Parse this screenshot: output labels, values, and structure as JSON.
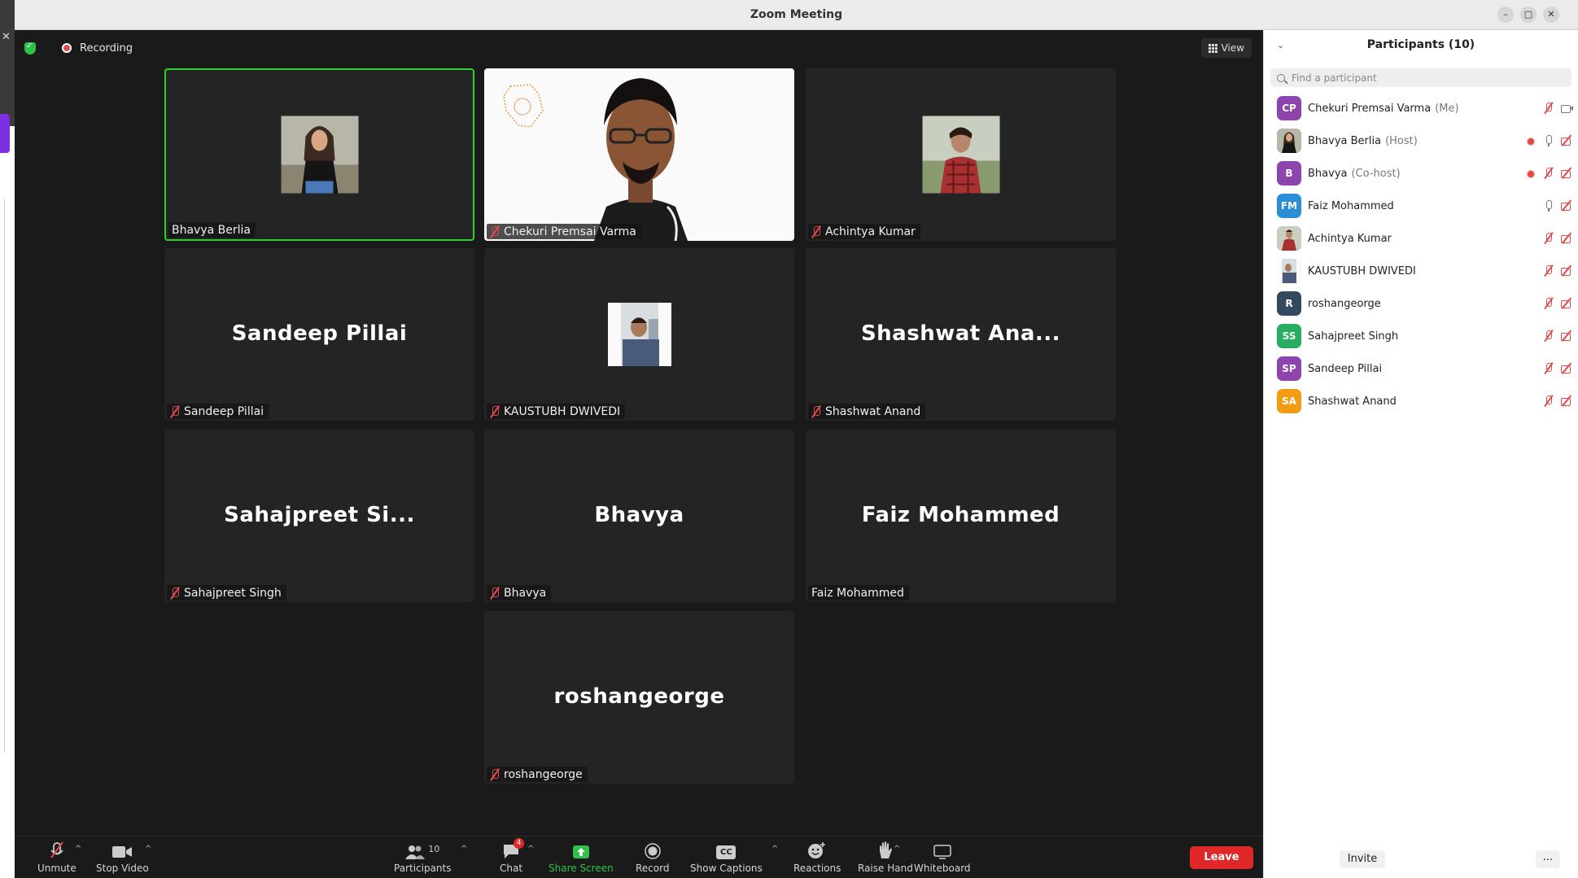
{
  "window": {
    "title": "Zoom Meeting"
  },
  "status": {
    "recording_label": "Recording",
    "view_label": "View"
  },
  "tiles": [
    {
      "display_name": "",
      "tag": "Bhavya Berlia"
    },
    {
      "display_name": "",
      "tag": "Chekuri Premsai Varma"
    },
    {
      "display_name": "",
      "tag": "Achintya Kumar"
    },
    {
      "display_name": "Sandeep Pillai",
      "tag": "Sandeep Pillai"
    },
    {
      "display_name": "",
      "tag": "KAUSTUBH DWIVEDI"
    },
    {
      "display_name": "Shashwat Ana...",
      "tag": "Shashwat Anand"
    },
    {
      "display_name": "Sahajpreet Si...",
      "tag": "Sahajpreet Singh"
    },
    {
      "display_name": "Bhavya",
      "tag": "Bhavya"
    },
    {
      "display_name": "Faiz Mohammed",
      "tag": "Faiz Mohammed"
    },
    {
      "display_name": "roshangeorge",
      "tag": "roshangeorge"
    }
  ],
  "toolbar": {
    "unmute": "Unmute",
    "stop_video": "Stop Video",
    "participants": "Participants",
    "participants_count": "10",
    "chat": "Chat",
    "chat_badge": "4",
    "share_screen": "Share Screen",
    "record": "Record",
    "show_captions": "Show Captions",
    "captions_icon_text": "CC",
    "reactions": "Reactions",
    "raise_hand": "Raise Hand",
    "whiteboard": "Whiteboard",
    "leave": "Leave"
  },
  "panel": {
    "title": "Participants (10)",
    "search_placeholder": "Find a participant",
    "invite": "Invite",
    "more": "...",
    "participants": [
      {
        "initials": "CP",
        "name": "Chekuri Premsai Varma",
        "role": "(Me)",
        "color": "#8e44ad"
      },
      {
        "initials": "",
        "name": "Bhavya Berlia",
        "role": "(Host)",
        "color": "#7a5a48"
      },
      {
        "initials": "B",
        "name": "Bhavya",
        "role": "(Co-host)",
        "color": "#8e44ad"
      },
      {
        "initials": "FM",
        "name": "Faiz Mohammed",
        "role": "",
        "color": "#2a8fd6"
      },
      {
        "initials": "",
        "name": "Achintya Kumar",
        "role": "",
        "color": "#6b4a3a"
      },
      {
        "initials": "",
        "name": "KAUSTUBH DWIVEDI",
        "role": "",
        "color": "#888888"
      },
      {
        "initials": "R",
        "name": "roshangeorge",
        "role": "",
        "color": "#34495e"
      },
      {
        "initials": "SS",
        "name": "Sahajpreet Singh",
        "role": "",
        "color": "#27ae60"
      },
      {
        "initials": "SP",
        "name": "Sandeep Pillai",
        "role": "",
        "color": "#8e44ad"
      },
      {
        "initials": "SA",
        "name": "Shashwat Anand",
        "role": "",
        "color": "#f39c12"
      }
    ]
  }
}
